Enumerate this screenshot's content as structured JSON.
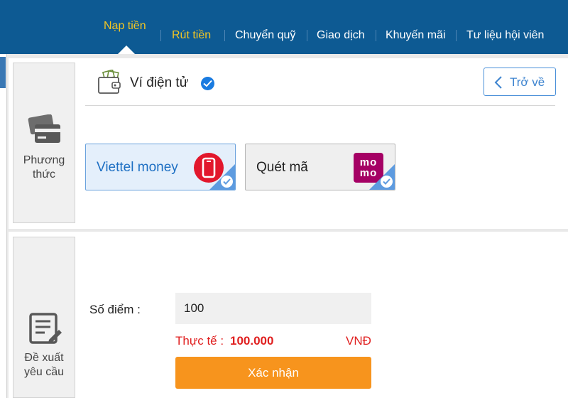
{
  "nav": {
    "items": [
      {
        "label": "Nạp tiền",
        "active": true
      },
      {
        "label": "Rút tiền",
        "active": false
      },
      {
        "label": "Chuyển quỹ",
        "active": false
      },
      {
        "label": "Giao dịch",
        "active": false
      },
      {
        "label": "Khuyến mãi",
        "active": false
      },
      {
        "label": "Tư liệu hội viên",
        "active": false
      }
    ],
    "bg_color": "#0d5a93",
    "active_color": "#f3c623"
  },
  "method_section": {
    "side_label_line1": "Phương",
    "side_label_line2": "thức",
    "side_icon": "credit-card-icon",
    "wallet_title": "Ví điện tử",
    "wallet_icon": "wallet-icon",
    "back_label": "Trở về",
    "methods": [
      {
        "name": "Viettel money",
        "selected": true,
        "logo": "viettel-money-logo"
      },
      {
        "name": "Quét mã",
        "selected": false,
        "logo": "momo-logo",
        "logo_text_line1": "mo",
        "logo_text_line2": "mo"
      }
    ]
  },
  "request_section": {
    "side_label_line1": "Đề xuất",
    "side_label_line2": "yêu cầu",
    "side_icon": "form-edit-icon",
    "points_label": "Số điểm :",
    "points_value": "100",
    "actual_label": "Thực tế :",
    "actual_value": "100.000",
    "currency": "VNĐ",
    "confirm_label": "Xác nhận",
    "confirm_color": "#f7941d",
    "highlight_color": "#e02020"
  }
}
